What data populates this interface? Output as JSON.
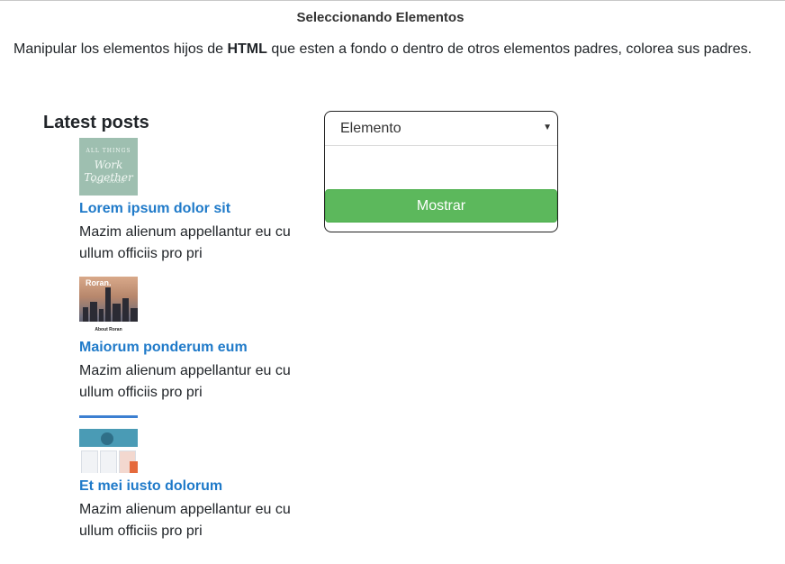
{
  "header": {
    "title": "Seleccionando Elementos"
  },
  "intro": {
    "before": "Manipular los elementos hijos de ",
    "bold": "HTML",
    "after": " que esten a fondo o dentro de otros elementos padres, colorea sus padres."
  },
  "posts": {
    "heading": "Latest posts",
    "items": [
      {
        "title": "Lorem ipsum dolor sit",
        "excerpt_line1": "Mazim alienum appellantur eu cu",
        "excerpt_line2": "ullum officiis pro pri",
        "thumb_top": "ALL THINGS",
        "thumb_script": "Work Together",
        "thumb_bottom": "FOR GOOD"
      },
      {
        "title": "Maiorum ponderum eum",
        "excerpt_line1": "Mazim alienum appellantur eu cu",
        "excerpt_line2": "ullum officiis pro pri",
        "thumb_brand": "Roran.",
        "thumb_caption": "About Roran"
      },
      {
        "title": "Et mei iusto dolorum",
        "excerpt_line1": "Mazim alienum appellantur eu cu",
        "excerpt_line2": "ullum officiis pro pri"
      }
    ]
  },
  "selector": {
    "selected": "Elemento",
    "caret": "▼",
    "button_label": "Mostrar"
  },
  "colors": {
    "link": "#1f7ac9",
    "button": "#5cb85c"
  }
}
